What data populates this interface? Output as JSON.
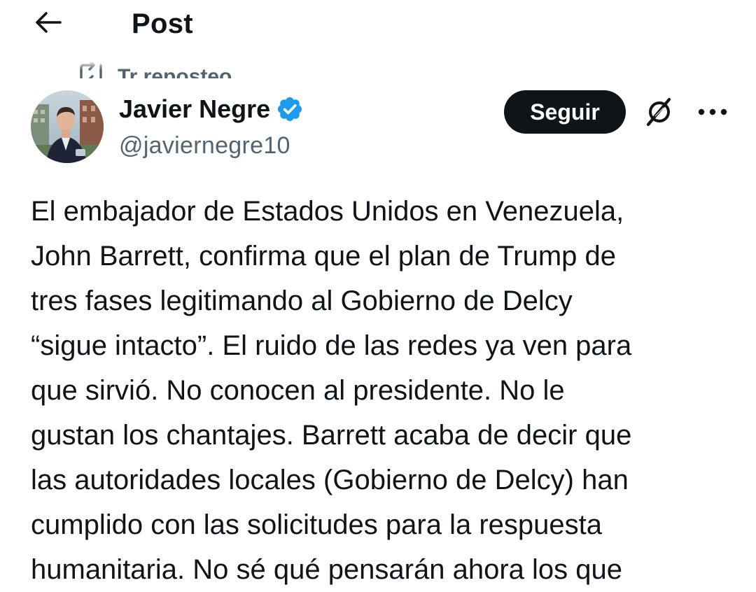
{
  "header": {
    "title": "Post",
    "back_icon": "arrow-left-icon"
  },
  "repost": {
    "icon": "repost-icon",
    "text": "Tr reposteo"
  },
  "author": {
    "name": "Javier Negre",
    "handle": "@javiernegre10",
    "verified": true,
    "verified_color": "#1d9bf0"
  },
  "actions": {
    "follow_label": "Seguir",
    "grok_icon": "grok-icon",
    "more_icon": "more-options-icon"
  },
  "post": {
    "lines": [
      "El embajador de Estados Unidos en Venezuela,",
      "John Barrett, confirma que el plan de Trump de",
      "tres fases legitimando al Gobierno de Delcy",
      "“sigue intacto”. El ruido de las redes ya ven para",
      "que sirvió. No conocen al presidente. No le",
      "gustan los chantajes. Barrett acaba de decir que",
      "las autoridades locales (Gobierno de Delcy) han",
      "cumplido con las solicitudes para la respuesta",
      "humanitaria. No sé qué pensarán ahora los que"
    ]
  },
  "colors": {
    "text_primary": "#0f1419",
    "text_secondary": "#536471",
    "follow_bg": "#0f1419",
    "follow_text": "#ffffff"
  }
}
